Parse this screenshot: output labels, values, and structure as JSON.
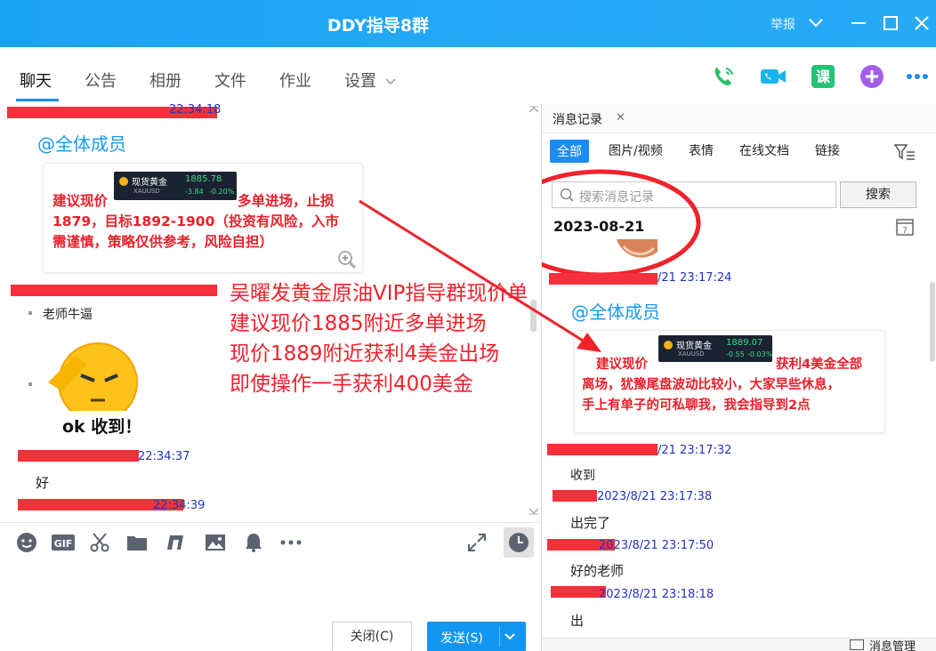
{
  "window": {
    "title": "DDY指导8群",
    "report": "举报",
    "controls": [
      "minimize-icon",
      "chevron-down-icon",
      "maximize-icon",
      "close-icon"
    ]
  },
  "tabs": [
    {
      "label": "聊天",
      "active": true
    },
    {
      "label": "公告",
      "active": false
    },
    {
      "label": "相册",
      "active": false
    },
    {
      "label": "文件",
      "active": false
    },
    {
      "label": "作业",
      "active": false
    },
    {
      "label": "设置",
      "active": false
    }
  ],
  "toolbar_icons": [
    "phone-icon",
    "video-call-icon",
    "course-icon",
    "add-app-icon",
    "more-icon"
  ],
  "toolbar_course_label": "课",
  "colors": {
    "accent": "#1d8cf0",
    "redact": "#f4303a",
    "overlay_red": "#f0222c",
    "timestamp_blue": "#2233bb",
    "at_all": "#1a9aee"
  },
  "chat": {
    "messages": [
      {
        "timestamp": "22:34:18",
        "at_all": "@全体成员",
        "image_text": "建议现价              多单进场，止损1879，目标1892-1900（投资有风险，入市需谨慎，策略仅供参考，风险自担）",
        "image_text_line1a": "建议现价",
        "image_text_line1b": "多单进场，止损",
        "image_text_line2": "1879，目标1892-1900（投资有风险，入市",
        "image_text_line3": "需谨慎，策略仅供参考，风险自担）",
        "quote": {
          "name": "现货黄金",
          "code": "XAUUSD",
          "price": "1885.78",
          "change": "-3.84",
          "pct": "-0.20%"
        }
      },
      {
        "text": "老师牛逼"
      },
      {
        "sticker_text": "ok 收到！"
      },
      {
        "timestamp": "22:34:37",
        "text": "好"
      },
      {
        "timestamp": "22:34:39"
      }
    ],
    "overlay_lines": [
      "吴曜发黄金原油VIP指导群现价单",
      "建议现价1885附近多单进场",
      "现价1889附近获利4美金出场",
      "即使操作一手获利400美金"
    ]
  },
  "input": {
    "icons": [
      "emoji-icon",
      "gif-icon",
      "scissors-icon",
      "folder-icon",
      "music-icon",
      "image-icon",
      "bell-icon",
      "more-dots-icon"
    ],
    "gif_label": "GIF",
    "right_icons": [
      "expand-icon",
      "history-clock-icon"
    ],
    "close_label": "关闭(C)",
    "send_label": "发送(S)"
  },
  "history": {
    "tab_label": "消息记录",
    "filters": [
      {
        "label": "全部",
        "active": true
      },
      {
        "label": "图片/视频",
        "active": false
      },
      {
        "label": "表情",
        "active": false
      },
      {
        "label": "在线文档",
        "active": false
      },
      {
        "label": "链接",
        "active": false
      }
    ],
    "search_placeholder": "搜索消息记录",
    "search_button": "搜索",
    "date": "2023-08-21",
    "entries": [
      {
        "timestamp": "/21 23:17:24",
        "at_all": "@全体成员",
        "image_line1a": "建议现价",
        "image_line1b": "获利4美金全部",
        "image_line2": "离场，犹豫尾盘波动比较小，大家早些休息，",
        "image_line3": "手上有单子的可私聊我，我会指导到2点",
        "quote": {
          "name": "现货黄金",
          "code": "XAUUSD",
          "price": "1889.07",
          "change": "-0.55",
          "pct": "-0.03%"
        }
      },
      {
        "timestamp": "/21 23:17:32",
        "text": "收到"
      },
      {
        "timestamp": "2023/8/21 23:17:38",
        "text": "出完了"
      },
      {
        "timestamp": "2023/8/21 23:17:50",
        "text": "好的老师"
      },
      {
        "timestamp": "2023/8/21 23:18:18",
        "text": "出"
      }
    ],
    "footer_label": "消息管理"
  }
}
